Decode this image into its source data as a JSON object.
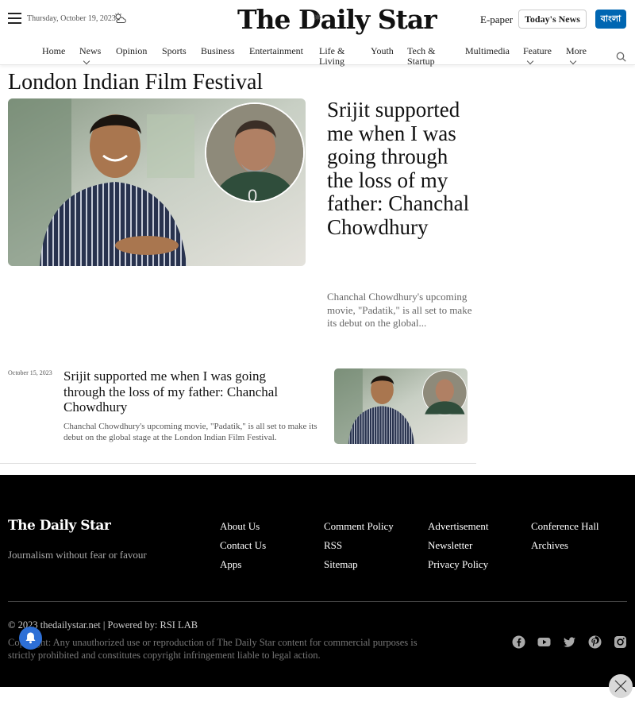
{
  "header": {
    "date": "Thursday, October 19, 2023",
    "logo_text": "The Daily Star",
    "epaper": "E-paper",
    "todays_news": "Today's News",
    "bangla": "বাংলা"
  },
  "nav": [
    {
      "label": "Home",
      "dropdown": false
    },
    {
      "label": "News",
      "dropdown": true
    },
    {
      "label": "Opinion",
      "dropdown": false
    },
    {
      "label": "Sports",
      "dropdown": false
    },
    {
      "label": "Business",
      "dropdown": false
    },
    {
      "label": "Entertainment",
      "dropdown": false
    },
    {
      "label": "Life & Living",
      "dropdown": false
    },
    {
      "label": "Youth",
      "dropdown": false
    },
    {
      "label": "Tech & Startup",
      "dropdown": false
    },
    {
      "label": "Multimedia",
      "dropdown": false
    },
    {
      "label": "Feature",
      "dropdown": true
    },
    {
      "label": "More",
      "dropdown": true
    }
  ],
  "page": {
    "title": "London Indian Film Festival"
  },
  "hero": {
    "title": "Srijit supported me when I was going through the loss of my father: Chanchal Chowdhury",
    "summary": "Chanchal Chowdhury's upcoming movie, \"Padatik,\" is all set to make its debut on the global..."
  },
  "list": [
    {
      "date": "October 15, 2023",
      "title": "Srijit supported me when I was going through the loss of my father: Chanchal Chowdhury",
      "summary": "Chanchal Chowdhury's upcoming movie, \"Padatik,\" is all set to make its debut on the global stage at the London Indian Film Festival."
    }
  ],
  "footer": {
    "logo_text": "The Daily Star",
    "tagline": "Journalism without fear or favour",
    "links": {
      "about": "About Us",
      "contact": "Contact Us",
      "apps": "Apps",
      "comment_policy": "Comment Policy",
      "rss": "RSS",
      "sitemap": "Sitemap",
      "advertisement": "Advertisement",
      "newsletter": "Newsletter",
      "privacy": "Privacy Policy",
      "conference": "Conference Hall",
      "archives": "Archives"
    },
    "copyright": "© 2023 thedailystar.net | Powered by: RSI LAB",
    "legal": "Copyright: Any unauthorized use or reproduction of The Daily Star content for commercial purposes is strictly prohibited and constitutes copyright infringement liable to legal action.",
    "social": [
      "facebook-icon",
      "youtube-icon",
      "twitter-icon",
      "pinterest-icon",
      "instagram-icon"
    ]
  },
  "colors": {
    "brand_blue": "#0066b2",
    "footer_bg": "#000000"
  }
}
